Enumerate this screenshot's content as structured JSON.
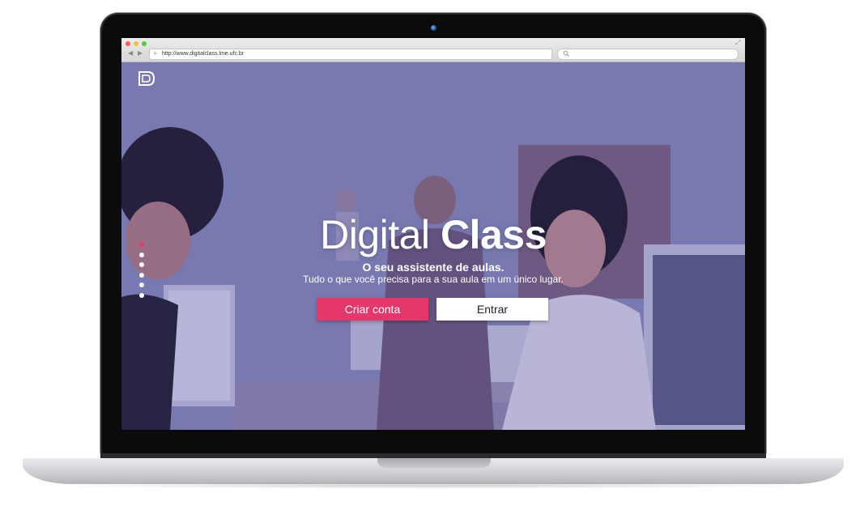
{
  "browser": {
    "url": "http://www.digitalclass.lme.ufc.br",
    "search_placeholder": ""
  },
  "hero": {
    "title_light": "Digital",
    "title_bold": "Class",
    "subtitle": "O seu assistente de aulas.",
    "tagline": "Tudo o que você precisa para a sua aula em um único lugar.",
    "primary_button": "Criar conta",
    "secondary_button": "Entrar",
    "slides": {
      "count": 6,
      "active_index": 0
    }
  },
  "colors": {
    "accent": "#e4386b",
    "overlay": "#6a64a8",
    "button_secondary": "#ffffff"
  },
  "icons": {
    "logo": "digital-class-logo-icon",
    "search": "search-icon",
    "expand": "expand-icon"
  }
}
